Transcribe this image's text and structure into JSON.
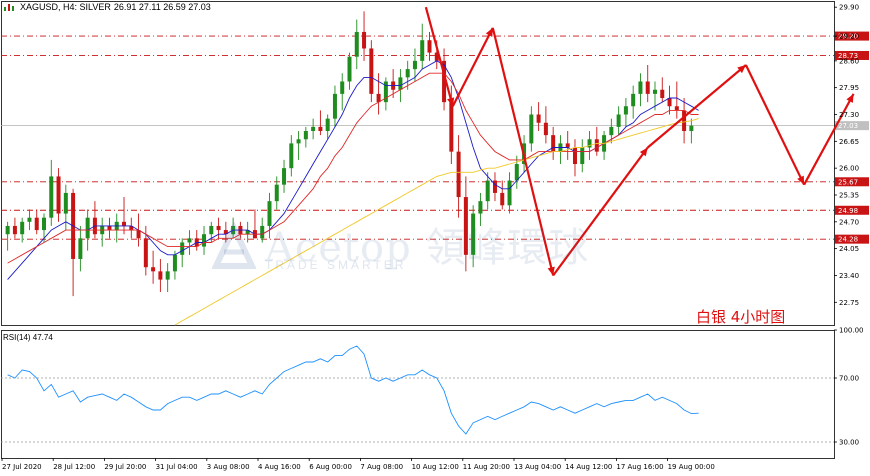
{
  "header": {
    "symbol": "XAGUSD, H4: SILVER",
    "ohlc": "26.91 27.11 26.59 27.03"
  },
  "watermark": {
    "brand": "Acetop 領峰環球",
    "tagline": "TRADE SMARTER"
  },
  "caption": "白银  4小时图",
  "colors": {
    "bull": "#1e8c1e",
    "bear": "#c81414",
    "ma_fast": "#1a1ac8",
    "ma_mid": "#e02828",
    "ma_slow": "#f0c828",
    "level_line": "#c81414",
    "arrows": "#e01010",
    "rsi_line": "#1e90ff"
  },
  "chart_data": [
    {
      "type": "candlestick",
      "title": "",
      "y_ticks": [
        "29.90",
        "29.20",
        "28.60",
        "27.95",
        "27.30",
        "26.65",
        "26.00",
        "25.35",
        "24.70",
        "24.05",
        "23.40",
        "22.75"
      ],
      "x_ticks": [
        "27 Jul 2020",
        "28 Jul 12:00",
        "29 Jul 20:00",
        "31 Jul 04:00",
        "3 Aug 08:00",
        "4 Aug 16:00",
        "6 Aug 00:00",
        "7 Aug 08:00",
        "10 Aug 12:00",
        "11 Aug 20:00",
        "13 Aug 04:00",
        "14 Aug 12:00",
        "17 Aug 16:00",
        "19 Aug 00:00"
      ],
      "ylim": [
        22.2,
        30.05
      ],
      "current_price": "27.03",
      "levels": [
        {
          "value": 29.2,
          "label": "29.20"
        },
        {
          "value": 28.73,
          "label": "28.73"
        },
        {
          "value": 25.67,
          "label": "25.67"
        },
        {
          "value": 24.98,
          "label": "24.98"
        },
        {
          "value": 24.28,
          "label": "24.28"
        }
      ],
      "candles": [
        [
          24.4,
          24.7,
          24.0,
          24.6
        ],
        [
          24.6,
          24.8,
          24.3,
          24.4
        ],
        [
          24.4,
          24.8,
          24.2,
          24.7
        ],
        [
          24.7,
          25.0,
          24.5,
          24.8
        ],
        [
          24.8,
          25.0,
          24.4,
          24.5
        ],
        [
          24.5,
          24.9,
          24.2,
          24.8
        ],
        [
          24.8,
          26.2,
          24.6,
          25.8
        ],
        [
          25.8,
          26.0,
          24.7,
          24.9
        ],
        [
          24.9,
          25.6,
          24.5,
          25.4
        ],
        [
          25.4,
          25.5,
          22.9,
          23.8
        ],
        [
          23.8,
          24.6,
          23.5,
          24.3
        ],
        [
          24.3,
          25.0,
          24.0,
          24.8
        ],
        [
          24.8,
          25.2,
          24.3,
          24.4
        ],
        [
          24.4,
          24.8,
          24.1,
          24.6
        ],
        [
          24.6,
          24.8,
          24.3,
          24.5
        ],
        [
          24.5,
          24.9,
          24.2,
          24.7
        ],
        [
          24.7,
          25.3,
          24.4,
          24.6
        ],
        [
          24.6,
          24.8,
          24.3,
          24.5
        ],
        [
          24.5,
          24.9,
          24.1,
          24.3
        ],
        [
          24.3,
          24.6,
          23.4,
          23.6
        ],
        [
          23.6,
          24.0,
          23.2,
          23.5
        ],
        [
          23.5,
          23.8,
          23.0,
          23.3
        ],
        [
          23.3,
          23.7,
          23.0,
          23.5
        ],
        [
          23.5,
          24.0,
          23.3,
          23.9
        ],
        [
          23.9,
          24.3,
          23.6,
          24.2
        ],
        [
          24.2,
          24.5,
          23.9,
          24.3
        ],
        [
          24.3,
          24.5,
          24.0,
          24.1
        ],
        [
          24.1,
          24.6,
          23.9,
          24.4
        ],
        [
          24.4,
          24.7,
          24.2,
          24.6
        ],
        [
          24.6,
          24.8,
          24.3,
          24.5
        ],
        [
          24.5,
          24.7,
          24.2,
          24.4
        ],
        [
          24.4,
          24.8,
          24.3,
          24.6
        ],
        [
          24.6,
          24.7,
          24.3,
          24.4
        ],
        [
          24.4,
          24.7,
          24.2,
          24.5
        ],
        [
          24.5,
          25.0,
          24.3,
          24.3
        ],
        [
          24.3,
          24.8,
          24.2,
          24.6
        ],
        [
          24.6,
          25.4,
          24.3,
          25.2
        ],
        [
          25.2,
          25.8,
          25.0,
          25.6
        ],
        [
          25.6,
          26.2,
          25.4,
          26.0
        ],
        [
          26.0,
          26.8,
          25.8,
          26.6
        ],
        [
          26.6,
          26.9,
          26.2,
          26.7
        ],
        [
          26.7,
          27.0,
          26.5,
          26.9
        ],
        [
          26.9,
          27.2,
          26.7,
          27.0
        ],
        [
          27.0,
          27.4,
          26.8,
          26.9
        ],
        [
          26.9,
          27.3,
          26.7,
          27.2
        ],
        [
          27.2,
          28.0,
          27.0,
          27.8
        ],
        [
          27.8,
          28.3,
          27.4,
          28.1
        ],
        [
          28.1,
          28.8,
          27.9,
          28.7
        ],
        [
          28.7,
          29.6,
          28.4,
          29.3
        ],
        [
          29.3,
          29.8,
          28.6,
          28.9
        ],
        [
          28.9,
          29.1,
          27.6,
          27.8
        ],
        [
          27.8,
          28.3,
          27.3,
          27.6
        ],
        [
          27.6,
          28.2,
          27.4,
          28.1
        ],
        [
          28.1,
          28.4,
          27.7,
          27.9
        ],
        [
          27.9,
          28.4,
          27.6,
          28.2
        ],
        [
          28.2,
          28.6,
          27.9,
          28.4
        ],
        [
          28.4,
          28.9,
          28.1,
          28.6
        ],
        [
          28.6,
          29.5,
          28.4,
          29.1
        ],
        [
          29.1,
          29.3,
          28.6,
          28.8
        ],
        [
          28.8,
          29.1,
          28.4,
          28.6
        ],
        [
          28.6,
          28.9,
          27.4,
          27.6
        ],
        [
          27.6,
          28.0,
          26.1,
          26.4
        ],
        [
          26.4,
          26.8,
          24.8,
          25.3
        ],
        [
          25.3,
          25.8,
          23.5,
          23.9
        ],
        [
          23.9,
          25.1,
          23.6,
          24.9
        ],
        [
          24.9,
          25.4,
          24.6,
          25.2
        ],
        [
          25.2,
          25.9,
          25.0,
          25.7
        ],
        [
          25.7,
          25.9,
          25.2,
          25.4
        ],
        [
          25.4,
          25.7,
          25.0,
          25.1
        ],
        [
          25.1,
          25.9,
          24.9,
          25.7
        ],
        [
          25.7,
          26.3,
          25.5,
          26.1
        ],
        [
          26.1,
          26.8,
          25.9,
          26.6
        ],
        [
          26.6,
          27.5,
          26.4,
          27.3
        ],
        [
          27.3,
          27.6,
          26.9,
          27.1
        ],
        [
          27.1,
          27.5,
          26.6,
          26.8
        ],
        [
          26.8,
          27.0,
          26.2,
          26.4
        ],
        [
          26.4,
          26.8,
          26.1,
          26.6
        ],
        [
          26.6,
          26.9,
          26.2,
          26.5
        ],
        [
          26.5,
          26.7,
          25.8,
          26.1
        ],
        [
          26.1,
          26.7,
          25.9,
          26.5
        ],
        [
          26.5,
          26.9,
          26.2,
          26.7
        ],
        [
          26.7,
          27.0,
          26.3,
          26.4
        ],
        [
          26.4,
          26.9,
          26.2,
          26.8
        ],
        [
          26.8,
          27.2,
          26.6,
          27.0
        ],
        [
          27.0,
          27.5,
          26.8,
          27.3
        ],
        [
          27.3,
          27.7,
          27.0,
          27.5
        ],
        [
          27.5,
          28.0,
          27.2,
          27.8
        ],
        [
          27.8,
          28.3,
          27.5,
          28.1
        ],
        [
          28.1,
          28.5,
          27.6,
          27.8
        ],
        [
          27.8,
          28.1,
          27.4,
          27.9
        ],
        [
          27.9,
          28.2,
          27.6,
          27.7
        ],
        [
          27.7,
          28.0,
          27.3,
          27.5
        ],
        [
          27.5,
          28.1,
          27.2,
          27.4
        ],
        [
          27.4,
          27.7,
          26.6,
          26.9
        ],
        [
          26.9,
          27.2,
          26.6,
          27.03
        ]
      ],
      "series": [
        {
          "name": "",
          "role": "ma_fast",
          "values": [
            23.3,
            23.5,
            23.7,
            23.9,
            24.1,
            24.3,
            24.5,
            24.6,
            24.7,
            24.6,
            24.5,
            24.5,
            24.6,
            24.6,
            24.6,
            24.6,
            24.6,
            24.6,
            24.5,
            24.4,
            24.2,
            24.0,
            23.9,
            23.9,
            24.0,
            24.1,
            24.2,
            24.2,
            24.3,
            24.4,
            24.4,
            24.5,
            24.5,
            24.5,
            24.4,
            24.4,
            24.5,
            24.7,
            24.9,
            25.2,
            25.5,
            25.8,
            26.1,
            26.4,
            26.7,
            27.0,
            27.3,
            27.7,
            28.0,
            28.2,
            28.2,
            28.1,
            28.0,
            28.0,
            28.0,
            28.1,
            28.2,
            28.4,
            28.5,
            28.6,
            28.5,
            28.2,
            27.7,
            27.1,
            26.5,
            26.0,
            25.8,
            25.6,
            25.5,
            25.5,
            25.7,
            25.9,
            26.1,
            26.3,
            26.4,
            26.5,
            26.5,
            26.5,
            26.4,
            26.4,
            26.4,
            26.5,
            26.6,
            26.7,
            26.8,
            27.0,
            27.1,
            27.3,
            27.4,
            27.5,
            27.6,
            27.7,
            27.7,
            27.6,
            27.5,
            27.4
          ]
        },
        {
          "name": "",
          "role": "ma_mid",
          "values": [
            23.7,
            23.8,
            23.9,
            24.0,
            24.1,
            24.2,
            24.3,
            24.4,
            24.5,
            24.5,
            24.5,
            24.5,
            24.5,
            24.5,
            24.5,
            24.5,
            24.5,
            24.5,
            24.5,
            24.4,
            24.3,
            24.2,
            24.1,
            24.1,
            24.1,
            24.1,
            24.1,
            24.2,
            24.2,
            24.3,
            24.3,
            24.3,
            24.4,
            24.4,
            24.4,
            24.4,
            24.5,
            24.6,
            24.7,
            24.9,
            25.1,
            25.3,
            25.5,
            25.8,
            26.0,
            26.3,
            26.5,
            26.8,
            27.1,
            27.3,
            27.5,
            27.6,
            27.7,
            27.8,
            27.9,
            28.0,
            28.1,
            28.2,
            28.3,
            28.3,
            28.3,
            28.1,
            27.8,
            27.4,
            27.1,
            26.8,
            26.6,
            26.4,
            26.3,
            26.2,
            26.2,
            26.2,
            26.3,
            26.4,
            26.4,
            26.4,
            26.4,
            26.4,
            26.4,
            26.4,
            26.4,
            26.5,
            26.6,
            26.7,
            26.8,
            26.9,
            27.0,
            27.1,
            27.2,
            27.3,
            27.3,
            27.4,
            27.4,
            27.4,
            27.3,
            27.3
          ]
        },
        {
          "name": "",
          "role": "ma_slow",
          "values": [
            null,
            null,
            null,
            null,
            null,
            null,
            null,
            null,
            null,
            null,
            null,
            null,
            null,
            null,
            null,
            null,
            null,
            null,
            null,
            null,
            null,
            null,
            null,
            22.2,
            22.3,
            22.4,
            22.5,
            22.6,
            22.7,
            22.8,
            22.9,
            23.0,
            23.1,
            23.2,
            23.3,
            23.4,
            23.5,
            23.6,
            23.7,
            23.8,
            23.9,
            24.0,
            24.1,
            24.2,
            24.3,
            24.4,
            24.5,
            24.6,
            24.7,
            24.8,
            24.9,
            25.0,
            25.1,
            25.2,
            25.3,
            25.4,
            25.5,
            25.6,
            25.7,
            25.8,
            25.85,
            25.9,
            25.9,
            25.9,
            25.9,
            25.95,
            26.0,
            26.0,
            26.05,
            26.1,
            26.15,
            26.2,
            26.25,
            26.3,
            26.35,
            26.4,
            26.4,
            26.45,
            26.5,
            26.5,
            26.55,
            26.6,
            26.6,
            26.65,
            26.7,
            26.75,
            26.8,
            26.85,
            26.9,
            26.95,
            27.0,
            27.05,
            27.1,
            27.12,
            27.15,
            27.2
          ]
        }
      ],
      "arrows": [
        [
          [
            57.5,
            29.9
          ],
          [
            61.2,
            27.5
          ],
          [
            66.7,
            29.4
          ],
          [
            75,
            23.4
          ],
          [
            88,
            26.5
          ],
          [
            101.5,
            28.5
          ],
          [
            109.5,
            25.6
          ],
          [
            116.3,
            27.8
          ]
        ]
      ]
    },
    {
      "type": "line",
      "title": "RSI(14) 47.74",
      "ylim": [
        20,
        100
      ],
      "y_ticks": [
        "100.00",
        "70.00",
        "30.00"
      ],
      "series": [
        {
          "name": "RSI(14)",
          "values": [
            72,
            70,
            75,
            74,
            70,
            62,
            66,
            58,
            60,
            62,
            55,
            58,
            59,
            60,
            58,
            56,
            60,
            58,
            55,
            52,
            50,
            50,
            54,
            56,
            58,
            58,
            56,
            58,
            60,
            60,
            62,
            60,
            58,
            60,
            62,
            60,
            66,
            70,
            74,
            76,
            78,
            80,
            80,
            82,
            80,
            84,
            84,
            88,
            90,
            85,
            70,
            68,
            70,
            68,
            70,
            72,
            72,
            75,
            72,
            70,
            62,
            48,
            40,
            35,
            42,
            44,
            46,
            44,
            46,
            48,
            50,
            52,
            55,
            54,
            52,
            50,
            52,
            50,
            48,
            50,
            52,
            54,
            52,
            54,
            55,
            56,
            56,
            58,
            60,
            56,
            58,
            56,
            54,
            50,
            47.74,
            48
          ]
        }
      ]
    }
  ]
}
